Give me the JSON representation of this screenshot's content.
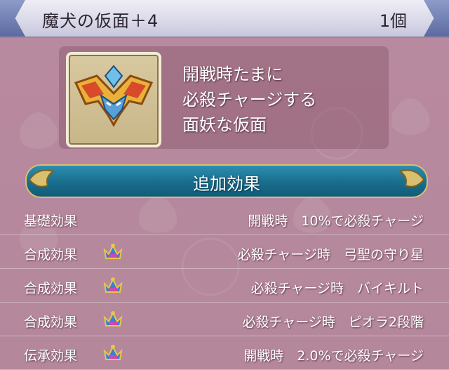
{
  "header": {
    "title": "魔犬の仮面＋4",
    "count": "1個"
  },
  "item": {
    "description_lines": [
      "開戦時たまに",
      "必殺チャージする",
      "面妖な仮面"
    ],
    "icon": "mask-icon"
  },
  "effects_header": "追加効果",
  "effects": [
    {
      "label": "基礎効果",
      "has_crown": false,
      "value": "開戦時　10%で必殺チャージ"
    },
    {
      "label": "合成効果",
      "has_crown": true,
      "value": "必殺チャージ時　弓聖の守り星"
    },
    {
      "label": "合成効果",
      "has_crown": true,
      "value": "必殺チャージ時　バイキルト"
    },
    {
      "label": "合成効果",
      "has_crown": true,
      "value": "必殺チャージ時　ピオラ2段階"
    },
    {
      "label": "伝承効果",
      "has_crown": true,
      "value": "開戦時　2.0%で必殺チャージ"
    }
  ],
  "colors": {
    "background": "#b98aa0",
    "header_bar": "#1b6f8f",
    "title_bar": "#dcdbea"
  }
}
